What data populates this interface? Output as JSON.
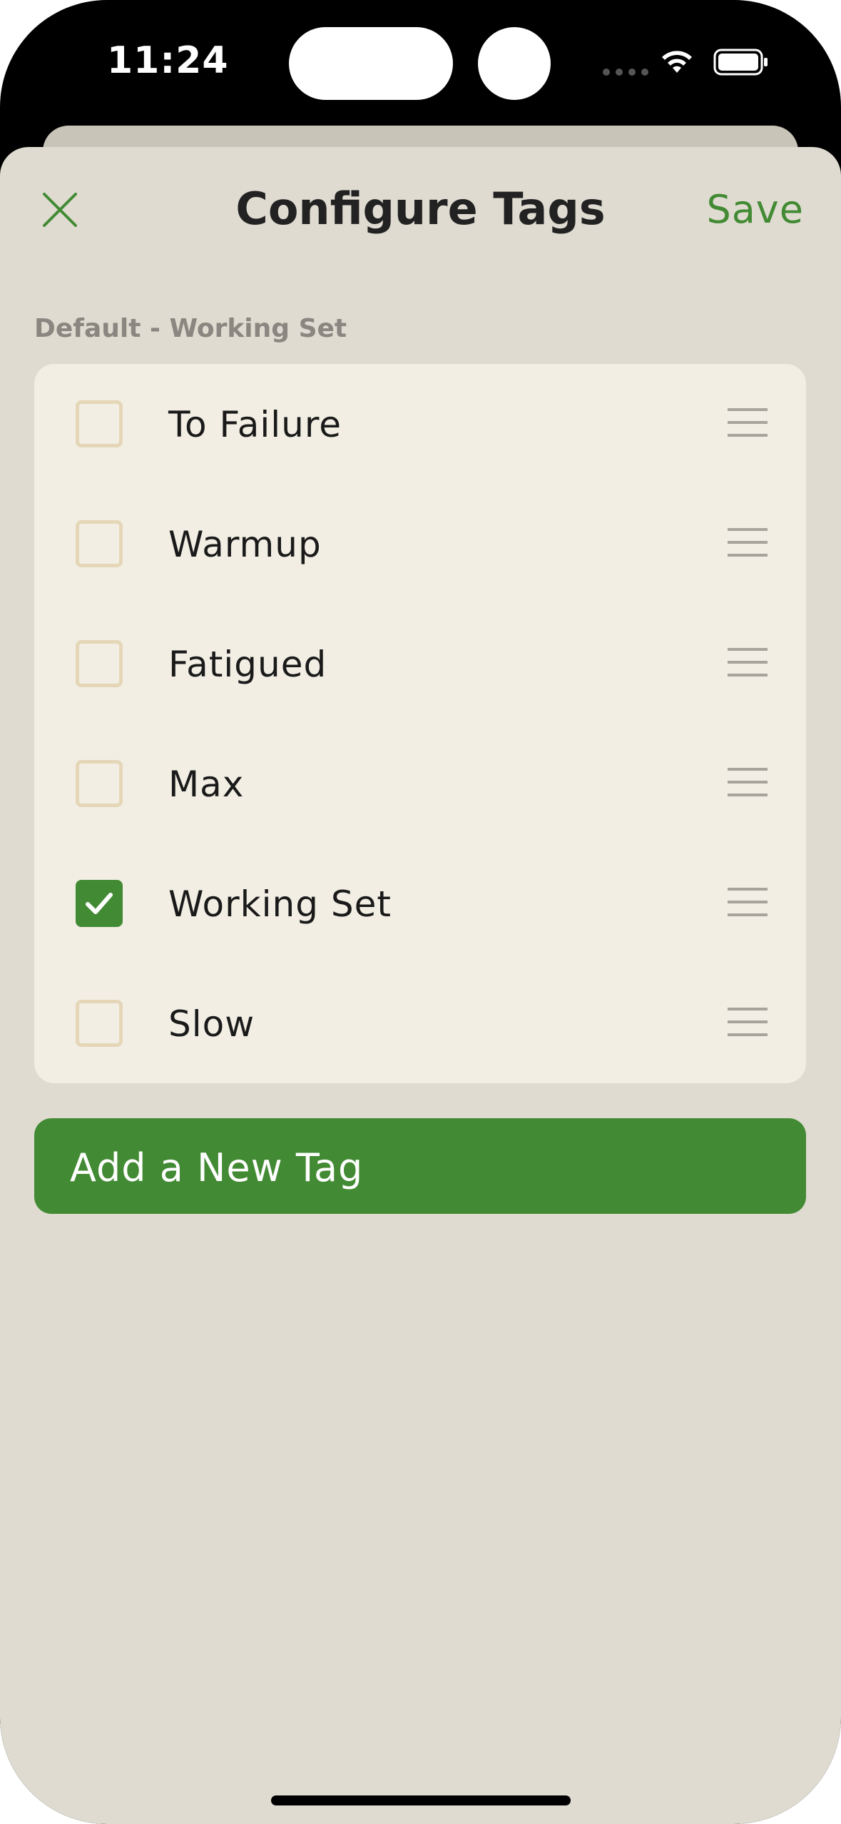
{
  "status_bar": {
    "time": "11:24"
  },
  "header": {
    "title": "Configure Tags",
    "save_label": "Save",
    "close_icon": "close-icon"
  },
  "section": {
    "label": "Default - Working Set"
  },
  "tags": [
    {
      "label": "To Failure",
      "checked": false
    },
    {
      "label": "Warmup",
      "checked": false
    },
    {
      "label": "Fatigued",
      "checked": false
    },
    {
      "label": "Max",
      "checked": false
    },
    {
      "label": "Working Set",
      "checked": true
    },
    {
      "label": "Slow",
      "checked": false
    }
  ],
  "add_button": {
    "label": "Add a New Tag"
  },
  "colors": {
    "accent": "#428a33",
    "sheet_background": "#dfdbd1",
    "card_background": "#f2eee4",
    "checkbox_border": "#e5d6b8"
  }
}
